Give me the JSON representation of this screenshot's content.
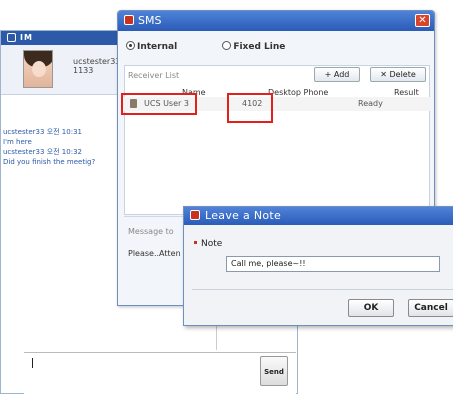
{
  "im": {
    "title": "IM",
    "profile": {
      "name": "ucstester33",
      "number": "1133"
    },
    "chat": [
      {
        "meta": "ucstester33 오전 10:31",
        "msg": "I'm here"
      },
      {
        "meta": "ucstester33 오전 10:32",
        "msg": "Did you finish the meetig?"
      }
    ],
    "send_label": "Send"
  },
  "sms": {
    "title": "SMS",
    "radio_internal": "Internal",
    "radio_fixed": "Fixed Line",
    "receiver_list_label": "Receiver List",
    "add_label": "+ Add",
    "delete_label": "✕ Delete",
    "columns": [
      "Name",
      "Desktop Phone",
      "Result"
    ],
    "rows": [
      {
        "name": "UCS User 3",
        "phone": "4102",
        "result": "Ready"
      }
    ],
    "message_label": "Message to",
    "message_body": "Please..Atten"
  },
  "note": {
    "title": "Leave a Note",
    "field_label": "Note",
    "value": "Call me, please~!!",
    "ok_label": "OK",
    "cancel_label": "Cancel"
  },
  "colors": {
    "highlight": "#e3201b",
    "title_bar": "#2a5cb8",
    "accent": "#c8321e"
  }
}
